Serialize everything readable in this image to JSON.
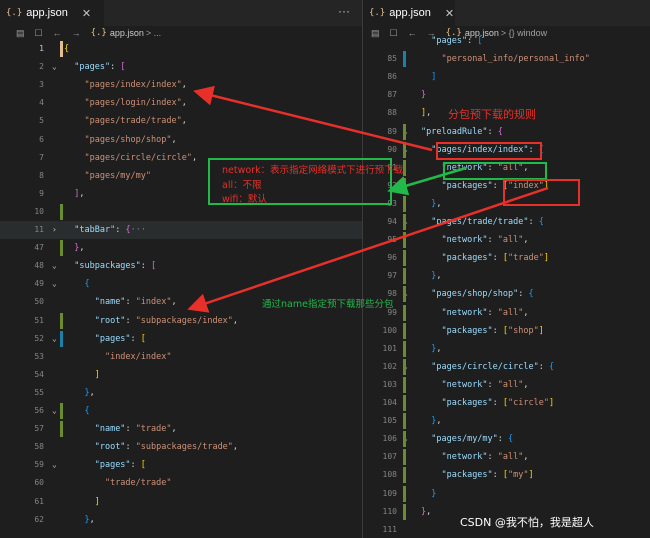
{
  "left_tab": {
    "icon": "{.}",
    "title": "app.json",
    "close": "✕"
  },
  "left_actions": "···",
  "left_breadcrumb": {
    "brace": "{.}",
    "file": "app.json",
    "sep": "> ..."
  },
  "right_tab": {
    "icon": "{.}",
    "title": "app.json",
    "close": "✕"
  },
  "right_breadcrumb": {
    "brace": "{.}",
    "file": "app.json",
    "sep": "> {} window"
  },
  "left_lines": [
    {
      "n": "1",
      "text": "{"
    },
    {
      "n": "2",
      "text": "  \"pages\": ["
    },
    {
      "n": "3",
      "text": "    \"pages/index/index\","
    },
    {
      "n": "4",
      "text": "    \"pages/login/index\","
    },
    {
      "n": "5",
      "text": "    \"pages/trade/trade\","
    },
    {
      "n": "6",
      "text": "    \"pages/shop/shop\","
    },
    {
      "n": "7",
      "text": "    \"pages/circle/circle\","
    },
    {
      "n": "8",
      "text": "    \"pages/my/my\""
    },
    {
      "n": "9",
      "text": "  ],"
    },
    {
      "n": "10",
      "text": ""
    },
    {
      "n": "11",
      "text": "  \"tabBar\": {···"
    },
    {
      "n": "47",
      "text": "  },"
    },
    {
      "n": "48",
      "text": "  \"subpackages\": ["
    },
    {
      "n": "49",
      "text": "    {"
    },
    {
      "n": "50",
      "text": "      \"name\": \"index\","
    },
    {
      "n": "51",
      "text": "      \"root\": \"subpackages/index\","
    },
    {
      "n": "52",
      "text": "      \"pages\": ["
    },
    {
      "n": "53",
      "text": "        \"index/index\""
    },
    {
      "n": "54",
      "text": "      ]"
    },
    {
      "n": "55",
      "text": "    },"
    },
    {
      "n": "56",
      "text": "    {"
    },
    {
      "n": "57",
      "text": "      \"name\": \"trade\","
    },
    {
      "n": "58",
      "text": "      \"root\": \"subpackages/trade\","
    },
    {
      "n": "59",
      "text": "      \"pages\": ["
    },
    {
      "n": "60",
      "text": "        \"trade/trade\""
    },
    {
      "n": "61",
      "text": "      ]"
    },
    {
      "n": "62",
      "text": "    },"
    }
  ],
  "right_lines": [
    {
      "n": "",
      "text": "  \"pages\": ["
    },
    {
      "n": "85",
      "text": "    \"personal_info/personal_info\""
    },
    {
      "n": "86",
      "text": "  ]"
    },
    {
      "n": "87",
      "text": "}"
    },
    {
      "n": "88",
      "text": "],"
    },
    {
      "n": "89",
      "text": "\"preloadRule\": {"
    },
    {
      "n": "90",
      "text": "  \"pages/index/index\": {"
    },
    {
      "n": "91",
      "text": "    \"network\": \"all\","
    },
    {
      "n": "92",
      "text": "    \"packages\": [\"index\"]"
    },
    {
      "n": "93",
      "text": "  },"
    },
    {
      "n": "94",
      "text": "  \"pages/trade/trade\": {"
    },
    {
      "n": "95",
      "text": "    \"network\": \"all\","
    },
    {
      "n": "96",
      "text": "    \"packages\": [\"trade\"]"
    },
    {
      "n": "97",
      "text": "  },"
    },
    {
      "n": "98",
      "text": "  \"pages/shop/shop\": {"
    },
    {
      "n": "99",
      "text": "    \"network\": \"all\","
    },
    {
      "n": "100",
      "text": "    \"packages\": [\"shop\"]"
    },
    {
      "n": "101",
      "text": "  },"
    },
    {
      "n": "102",
      "text": "  \"pages/circle/circle\": {"
    },
    {
      "n": "103",
      "text": "    \"network\": \"all\","
    },
    {
      "n": "104",
      "text": "    \"packages\": [\"circle\"]"
    },
    {
      "n": "105",
      "text": "  },"
    },
    {
      "n": "106",
      "text": "  \"pages/my/my\": {"
    },
    {
      "n": "107",
      "text": "    \"network\": \"all\","
    },
    {
      "n": "108",
      "text": "    \"packages\": [\"my\"]"
    },
    {
      "n": "109",
      "text": "  }"
    },
    {
      "n": "110",
      "text": "},"
    },
    {
      "n": "111",
      "text": ""
    }
  ],
  "annotations": {
    "subpackage_rule": "分包预下载的规则",
    "network_line": "network：表示指定网络模式下进行预下载",
    "all_line": "all：不限",
    "wifi_line": "wifi：默认",
    "name_note": "通过name指定预下载那些分包"
  },
  "watermark": "CSDN @我不怕，我是超人",
  "colors": {
    "annotation_red": "#e8302a",
    "annotation_green": "#22b84a",
    "key": "#9cdcfe",
    "string": "#ce9178"
  }
}
